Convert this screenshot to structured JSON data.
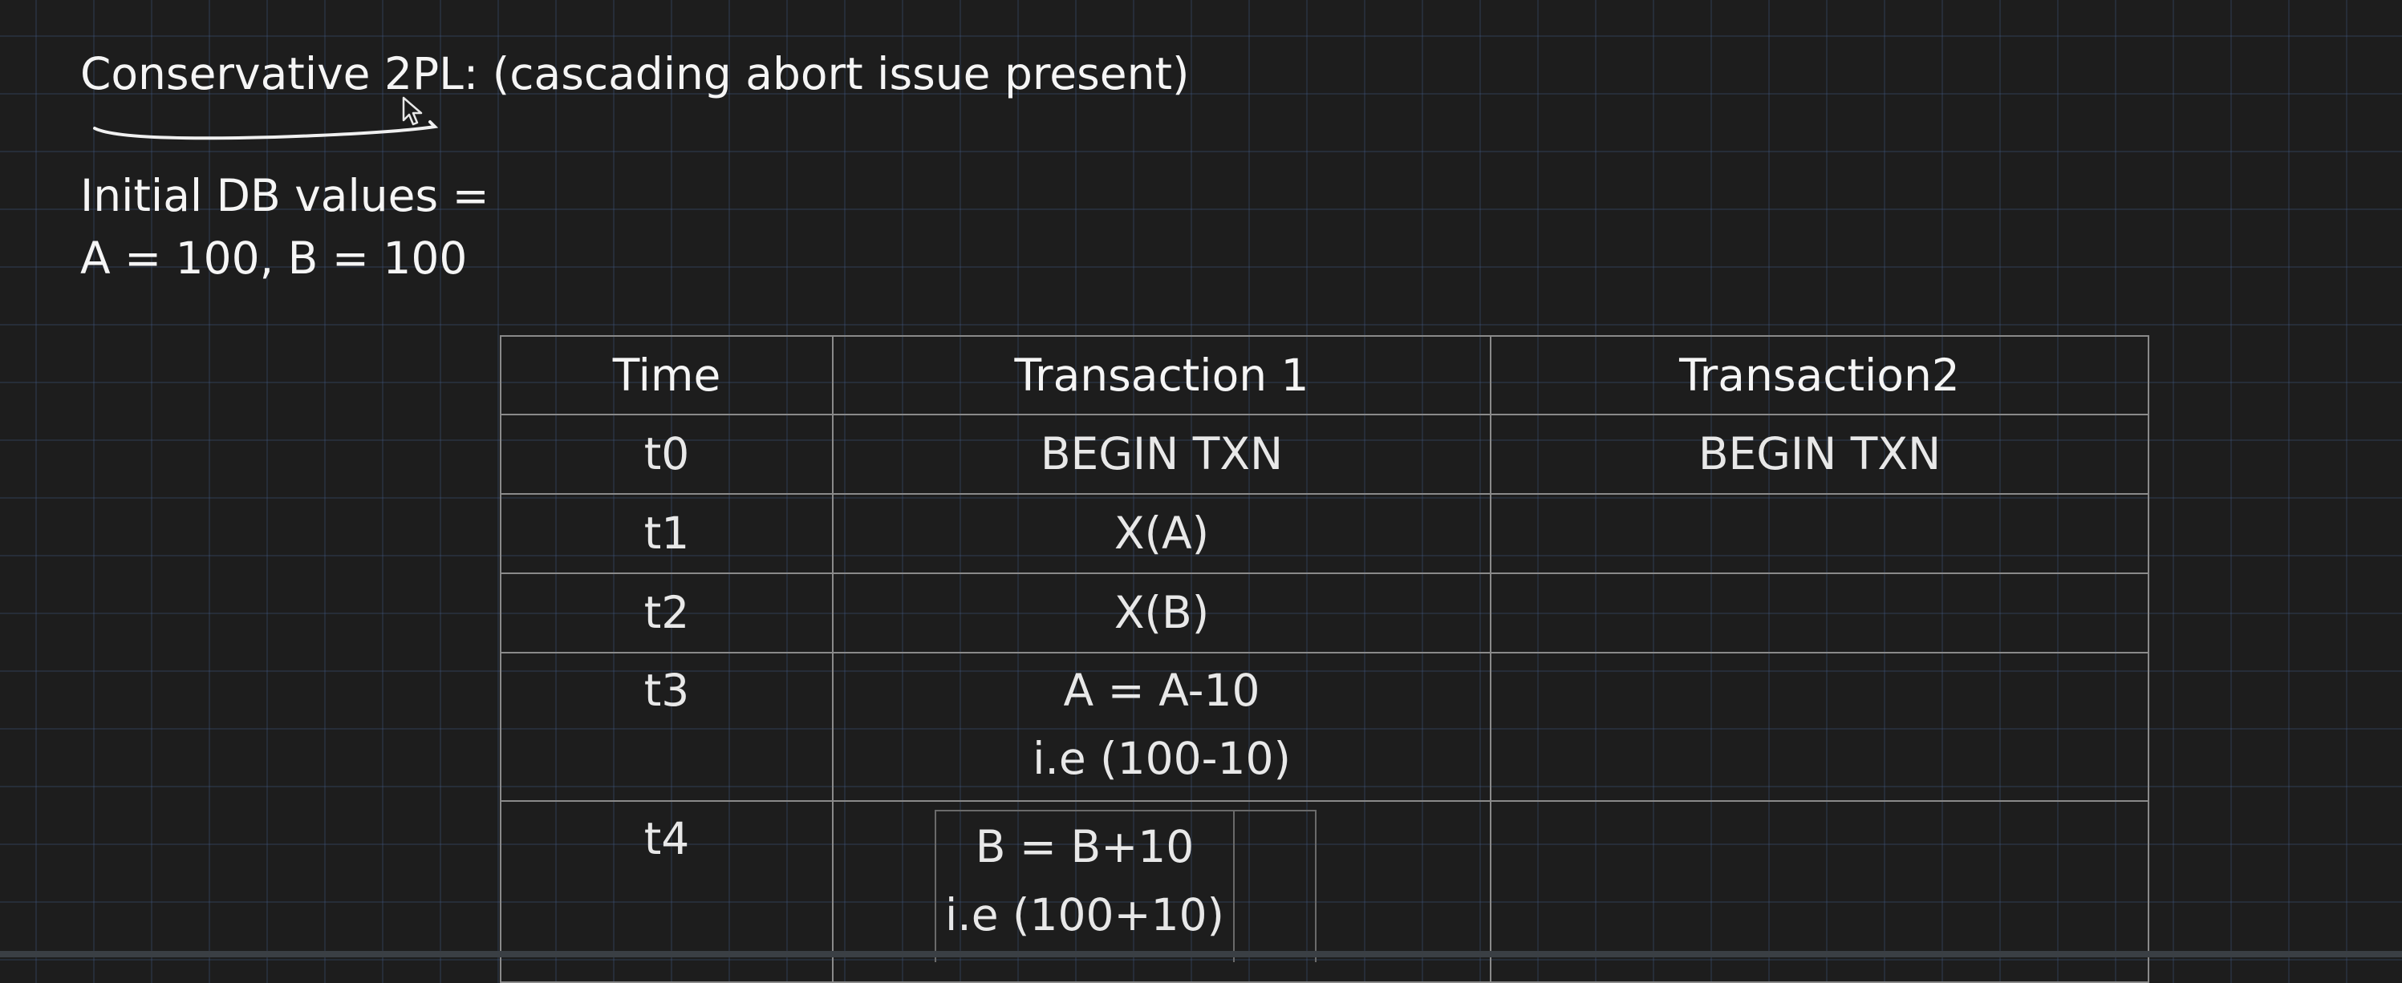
{
  "slide": {
    "title": "Conservative 2PL: (cascading abort issue present)",
    "initial_values_label": "Initial DB values =",
    "initial_values": "A = 100, B = 100"
  },
  "table": {
    "headers": {
      "time": "Time",
      "transaction1": "Transaction 1",
      "transaction2": "Transaction2"
    },
    "rows": [
      {
        "time": "t0",
        "txn1": "BEGIN TXN",
        "txn2": "BEGIN TXN"
      },
      {
        "time": "t1",
        "txn1": "X(A)",
        "txn2": ""
      },
      {
        "time": "t2",
        "txn1": "X(B)",
        "txn2": ""
      },
      {
        "time": "t3",
        "txn1_line1": "A = A-10",
        "txn1_line2": "i.e (100-10)",
        "txn2": ""
      },
      {
        "time": "t4",
        "txn1_line1": "B = B+10",
        "txn1_line2": "i.e (100+10)",
        "txn2": ""
      }
    ]
  },
  "colors": {
    "background": "#1d1d1d",
    "grid_line": "#46648f",
    "text": "#f0f0f0",
    "table_border": "#8a8a8a"
  },
  "icons": {
    "cursor": "mouse-pointer-icon",
    "underline": "handwritten-underline-stroke"
  }
}
